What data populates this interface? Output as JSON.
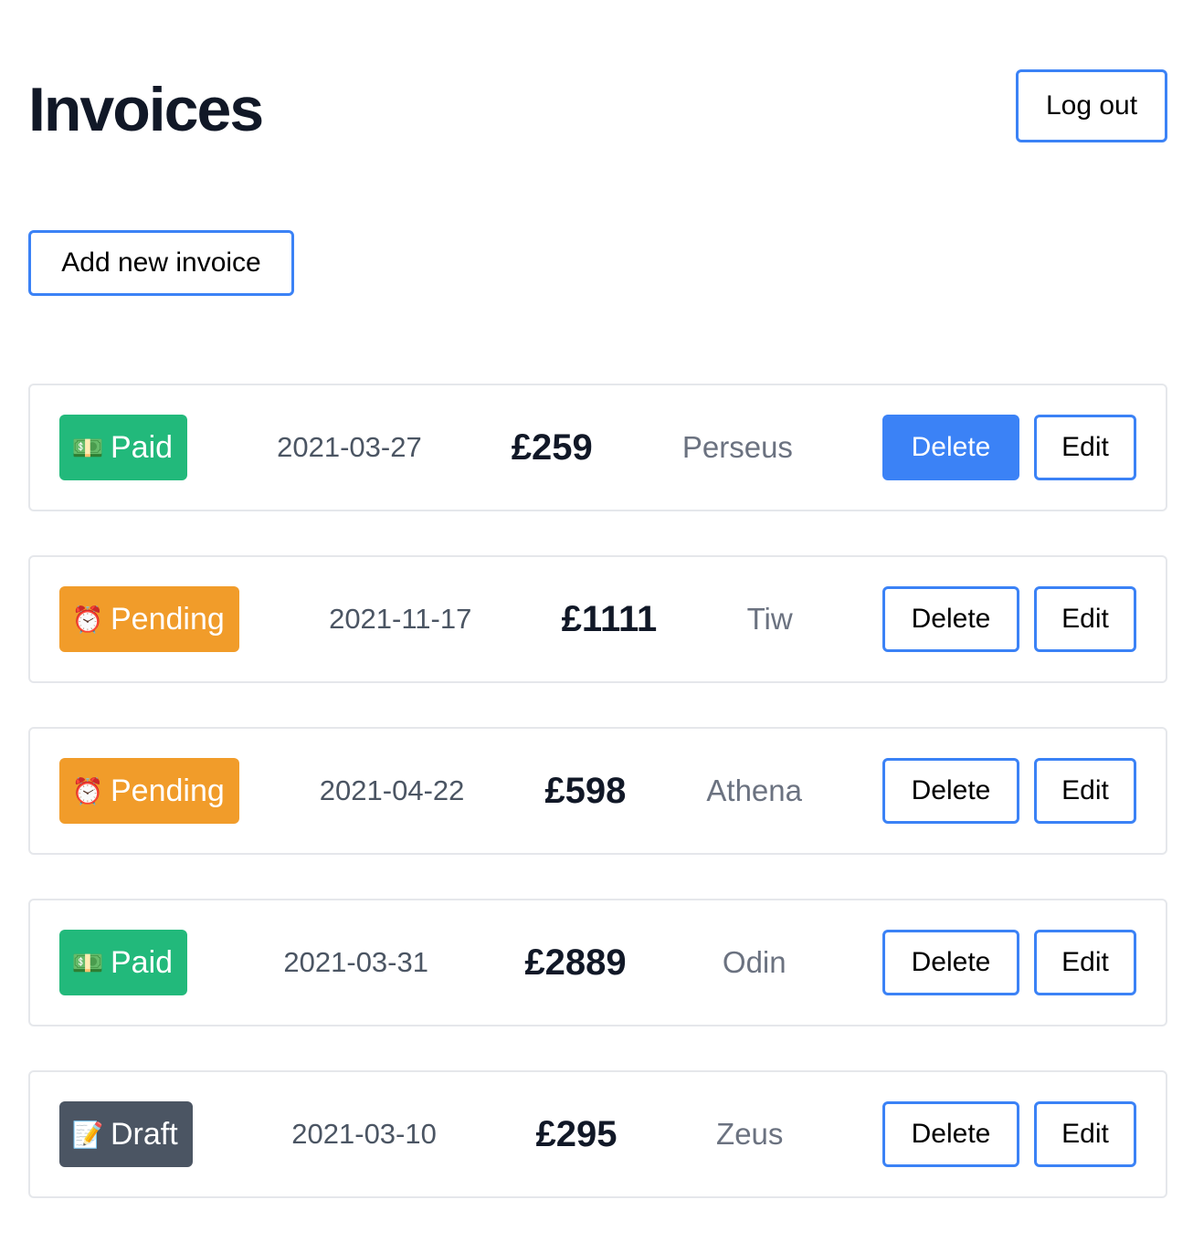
{
  "header": {
    "title": "Invoices",
    "logout_label": "Log out"
  },
  "toolbar": {
    "add_label": "Add new invoice"
  },
  "status_colors": {
    "paid": "#22b97b",
    "pending": "#f19c2a",
    "draft": "#4b5563",
    "accent": "#3b82f6"
  },
  "invoices": [
    {
      "status": "paid",
      "status_label": "Paid",
      "status_icon": "money-icon",
      "status_emoji": "💵",
      "date": "2021-03-27",
      "amount": "£259",
      "client": "Perseus",
      "delete_label": "Delete",
      "edit_label": "Edit",
      "delete_highlighted": true
    },
    {
      "status": "pending",
      "status_label": "Pending",
      "status_icon": "alarm-clock-icon",
      "status_emoji": "⏰",
      "date": "2021-11-17",
      "amount": "£1111",
      "client": "Tiw",
      "delete_label": "Delete",
      "edit_label": "Edit",
      "delete_highlighted": false
    },
    {
      "status": "pending",
      "status_label": "Pending",
      "status_icon": "alarm-clock-icon",
      "status_emoji": "⏰",
      "date": "2021-04-22",
      "amount": "£598",
      "client": "Athena",
      "delete_label": "Delete",
      "edit_label": "Edit",
      "delete_highlighted": false
    },
    {
      "status": "paid",
      "status_label": "Paid",
      "status_icon": "money-icon",
      "status_emoji": "💵",
      "date": "2021-03-31",
      "amount": "£2889",
      "client": "Odin",
      "delete_label": "Delete",
      "edit_label": "Edit",
      "delete_highlighted": false
    },
    {
      "status": "draft",
      "status_label": "Draft",
      "status_icon": "memo-icon",
      "status_emoji": "📝",
      "date": "2021-03-10",
      "amount": "£295",
      "client": "Zeus",
      "delete_label": "Delete",
      "edit_label": "Edit",
      "delete_highlighted": false
    }
  ]
}
